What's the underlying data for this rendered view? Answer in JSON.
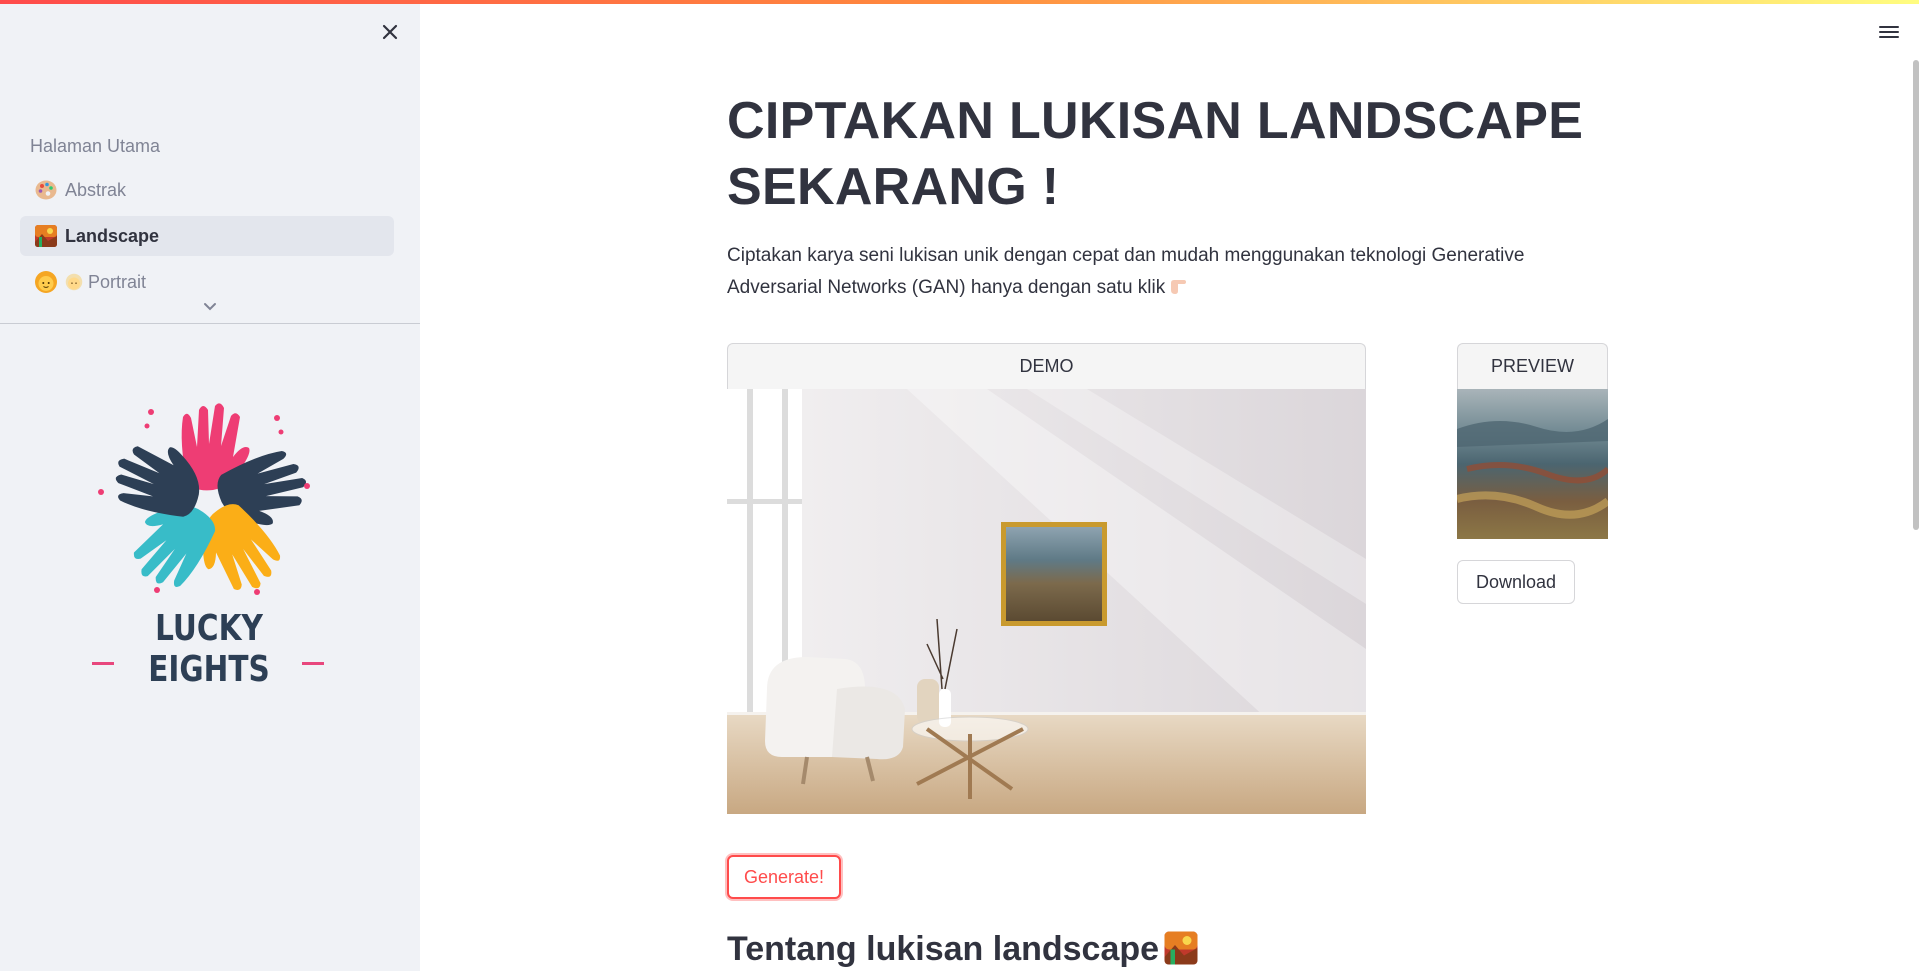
{
  "sidebar": {
    "nav_title": "Halaman Utama",
    "items": [
      {
        "label": "Abstrak",
        "icon": "palette-icon"
      },
      {
        "label": "Landscape",
        "icon": "framed-picture-icon",
        "active": true
      },
      {
        "label": "Portrait",
        "icon": "person-blond-icon"
      }
    ],
    "logo_text": "LUCKY EIGHTS"
  },
  "main": {
    "title": "CIPTAKAN LUKISAN LANDSCAPE SEKARANG !",
    "intro": "Ciptakan karya seni lukisan unik dengan cepat dan mudah menggunakan teknologi Generative Adversarial Networks (GAN) hanya dengan satu klik",
    "demo_label": "DEMO",
    "preview_label": "PREVIEW",
    "download_label": "Download",
    "generate_label": "Generate!",
    "section_heading": "Tentang lukisan landscape"
  },
  "colors": {
    "accent": "#ff4b4b",
    "sidebar_bg": "#f0f2f6",
    "text": "#31333f",
    "muted": "#808495"
  }
}
